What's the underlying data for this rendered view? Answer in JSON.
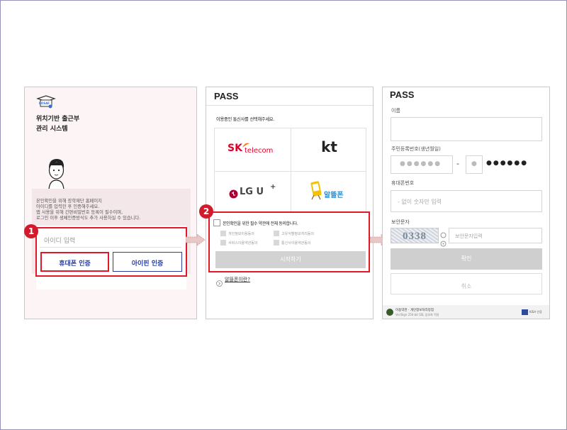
{
  "panel1": {
    "logo_text": "KOSAF",
    "title_line1": "위치기반 출근부",
    "title_line2": "관리 시스템",
    "desc_line1": "본인확인을 위해 장학재단 홈페이지",
    "desc_line2": "아이디를 입력한 후 인증해주세요.",
    "desc_line3": "앱 사용을 위해 간편비밀번호 등록이 필수이며,",
    "desc_line4": "로그인 이후 생체인증방식도 추가 사용하실 수 있습니다.",
    "id_placeholder": "아이디 입력",
    "phone_auth_label": "휴대폰 인증",
    "ipin_auth_label": "아이핀 인증"
  },
  "panel2": {
    "brand": "PASS",
    "instruction": "이용중인 통신사를 선택해주세요.",
    "carriers": [
      {
        "label": "SK telecom",
        "prefix": "SK",
        "suffix": "telecom"
      },
      {
        "label": "kt"
      },
      {
        "label": "LG U+",
        "text": "LG U",
        "sup": "+"
      },
      {
        "label": "알뜰폰"
      }
    ],
    "agree_all": "본인확인을 위한 필수 약관에 전체 동의합니다.",
    "agree_items": [
      "개인정보이용동의",
      "고유식별정보처리동의",
      "서비스이용약관동의",
      "통신사이용약관동의"
    ],
    "start_button": "시작하기",
    "mvno_link": "알뜰폰이란?"
  },
  "panel3": {
    "brand": "PASS",
    "name_label": "이름",
    "rrn_label": "주민등록번호(생년월일)",
    "rrn_front_mask": "●●●●●●",
    "rrn_dash": "-",
    "rrn_gender_mask": "●",
    "rrn_back_mask": "●●●●●●",
    "phone_label": "휴대폰번호",
    "phone_placeholder": "- 없이 숫자만 입력",
    "captcha_label": "보안문자",
    "captcha_text": "0338",
    "captcha_placeholder": "보안문자입력",
    "confirm_button": "확인",
    "cancel_button": "취소",
    "footer_text1": "이용약관 · 개인정보처리방침",
    "footer_text2": "VeriSign 256-bit SSL 암호화 적용",
    "footer_org": "KISA 인증"
  },
  "callouts": [
    "1",
    "2"
  ],
  "colors": {
    "accent_red": "#e0182a",
    "callout_red": "#d11b2b",
    "sk_red": "#e4002b",
    "lg_red": "#a50034",
    "kt_black": "#222222",
    "mvno_yellow": "#f5c200"
  }
}
